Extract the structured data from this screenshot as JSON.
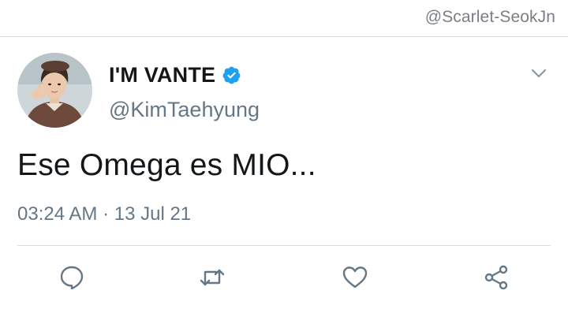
{
  "watermark": "@Scarlet-SeokJn",
  "tweet": {
    "display_name": "I'M VANTE",
    "handle": "@KimTaehyung",
    "text": "Ese Omega es MIO...",
    "timestamp": "03:24 AM · 13 Jul 21",
    "verified": true
  },
  "icons": {
    "avatar": "profile-photo",
    "verified": "verified-badge-icon",
    "menu": "chevron-down-icon",
    "reply": "reply-icon",
    "retweet": "retweet-icon",
    "like": "heart-icon",
    "share": "share-icon"
  },
  "colors": {
    "text_primary": "#14171a",
    "text_secondary": "#657786",
    "verified_blue": "#1da1f2",
    "icon_gray": "#657786",
    "divider": "#d9dde1"
  }
}
